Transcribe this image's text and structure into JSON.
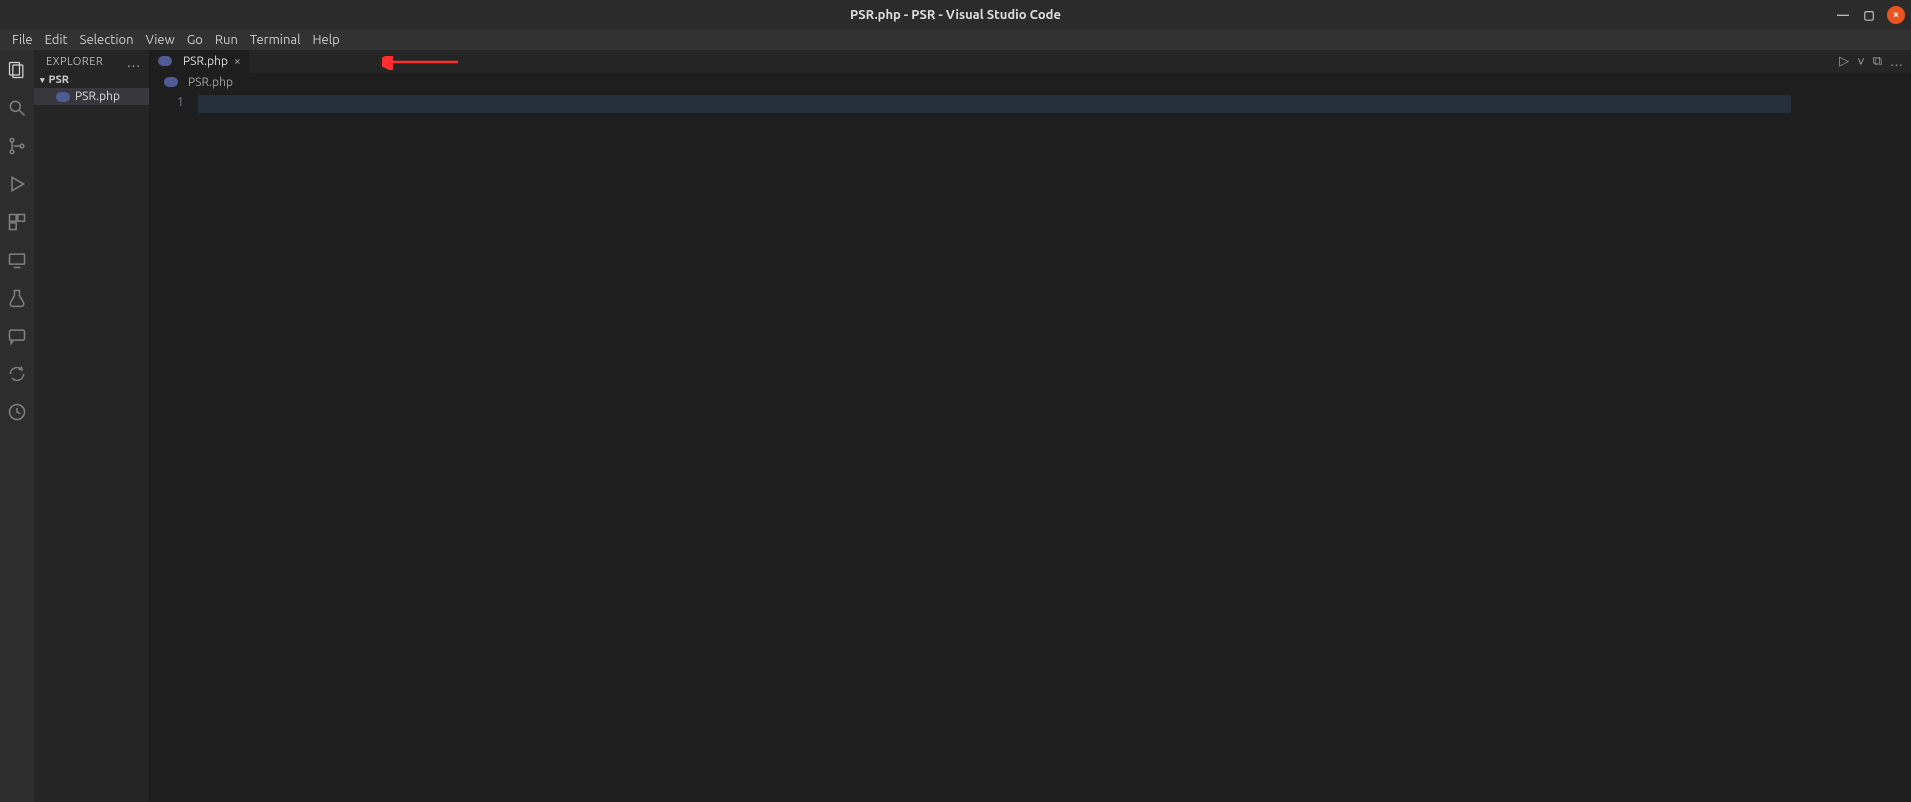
{
  "title": "PSR.php - PSR - Visual Studio Code",
  "window": {
    "minimize": "—",
    "maximize": "▢",
    "close": "×"
  },
  "menu": {
    "file": "File",
    "edit": "Edit",
    "selection": "Selection",
    "view": "View",
    "go": "Go",
    "run": "Run",
    "terminal": "Terminal",
    "help": "Help"
  },
  "sidebar": {
    "title": "EXPLORER",
    "ellipsis": "…",
    "folder": "PSR",
    "file": "PSR.php"
  },
  "tabs": [
    {
      "label": "PSR.php",
      "close": "×"
    }
  ],
  "tab_actions": {
    "run": "▷",
    "chev": "˅",
    "split": "⧉",
    "more": "…"
  },
  "breadcrumb": {
    "file": "PSR.php"
  },
  "editor": {
    "line1": "1"
  }
}
